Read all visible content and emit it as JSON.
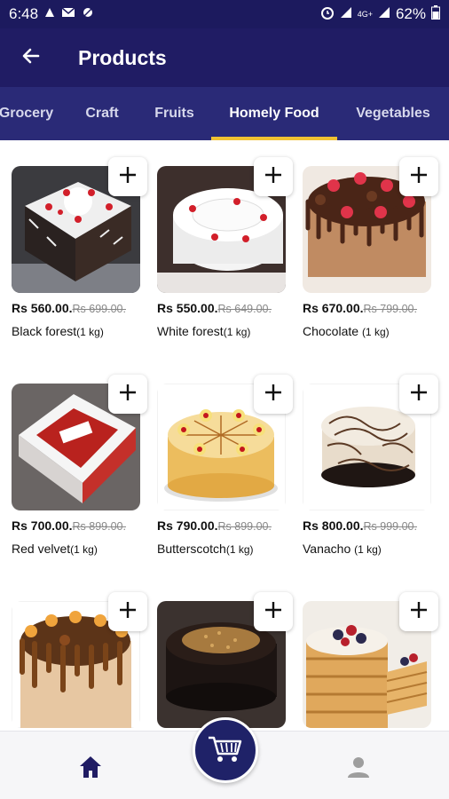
{
  "status_bar": {
    "time": "6:48",
    "battery": "62%",
    "network": "4G+"
  },
  "app_bar": {
    "title": "Products",
    "back_icon": "arrow-left-icon"
  },
  "tabs": [
    {
      "label": "Grocery",
      "active": false
    },
    {
      "label": "Craft",
      "active": false
    },
    {
      "label": "Fruits",
      "active": false
    },
    {
      "label": "Homely Food",
      "active": true
    },
    {
      "label": "Vegetables",
      "active": false
    }
  ],
  "products": [
    {
      "price": "Rs 560.00.",
      "old_price": "Rs 699.00.",
      "name": "Black forest",
      "weight": "(1 kg)"
    },
    {
      "price": "Rs 550.00.",
      "old_price": "Rs 649.00.",
      "name": "White forest",
      "weight": "(1 kg)"
    },
    {
      "price": "Rs 670.00.",
      "old_price": "Rs 799.00.",
      "name": "Chocolate ",
      "weight": "(1 kg)"
    },
    {
      "price": "Rs 700.00.",
      "old_price": "Rs 899.00.",
      "name": "Red velvet",
      "weight": "(1 kg)"
    },
    {
      "price": "Rs 790.00.",
      "old_price": "Rs 899.00.",
      "name": "Butterscotch",
      "weight": "(1 kg)"
    },
    {
      "price": "Rs 800.00.",
      "old_price": "Rs 999.00.",
      "name": "Vanacho ",
      "weight": "(1 kg)"
    }
  ],
  "add_icon": "plus-icon",
  "bottom_nav": {
    "home_icon": "home-icon",
    "cart_icon": "cart-icon",
    "profile_icon": "person-icon"
  },
  "colors": {
    "primary": "#201c64",
    "tab_bar": "#2a2a77",
    "indicator": "#f1c232"
  }
}
